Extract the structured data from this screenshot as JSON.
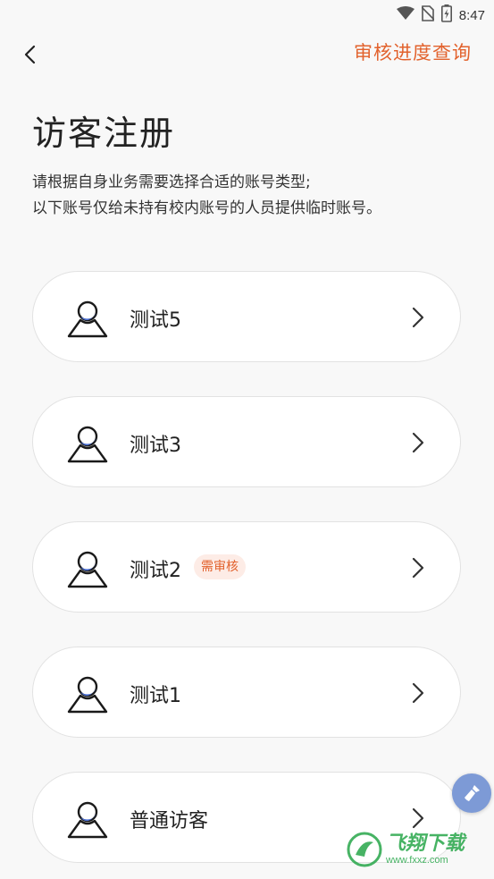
{
  "status_bar": {
    "time": "8:47",
    "icons": [
      "wifi-icon",
      "no-sim-icon",
      "battery-icon"
    ]
  },
  "header": {
    "back_icon": "chevron-left-icon",
    "progress_link": "审核进度查询"
  },
  "page": {
    "title": "访客注册",
    "subtitle_line1": "请根据自身业务需要选择合适的账号类型;",
    "subtitle_line2": "以下账号仅给未持有校内账号的人员提供临时账号。"
  },
  "account_types": [
    {
      "label": "测试5",
      "badge": ""
    },
    {
      "label": "测试3",
      "badge": ""
    },
    {
      "label": "测试2",
      "badge": "需审核"
    },
    {
      "label": "测试1",
      "badge": ""
    },
    {
      "label": "普通访客",
      "badge": ""
    }
  ],
  "floating_button_icon": "broom-icon",
  "watermark": {
    "main": "飞翔下载",
    "sub": "www.fxxz.com"
  },
  "colors": {
    "accent": "#e2622d",
    "badge_bg": "#fdece6",
    "icon_blue": "#4a6fd4",
    "icon_dark": "#1a1a1a",
    "card_border": "#e2e2e2",
    "background": "#f8f8f8"
  }
}
